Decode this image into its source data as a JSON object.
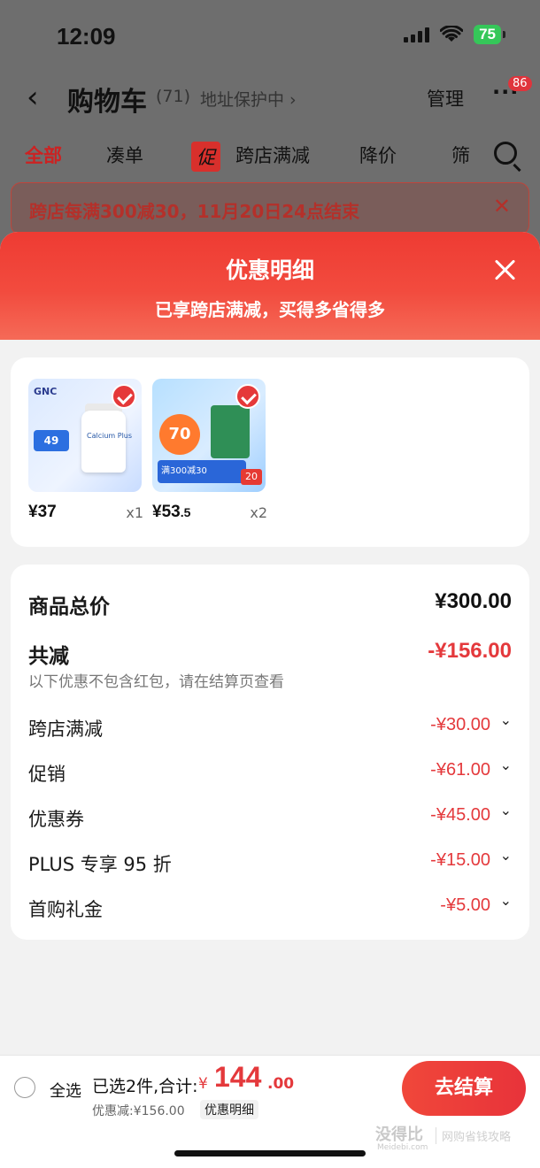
{
  "status_bar": {
    "time": "12:09",
    "battery": "75"
  },
  "navbar": {
    "back_icon": "chevron-left-icon",
    "title": "购物车",
    "count": "(71)",
    "address": "地址保护中 ›",
    "manage": "管理",
    "more": "···",
    "badge": "86"
  },
  "tabs": {
    "all": "全部",
    "together": "凑单",
    "promo_tag": "促",
    "cross_store": "跨店满减",
    "price_drop": "降价",
    "filter": "筛"
  },
  "notice": {
    "text": "跨店每满300减30，11月20日24点结束",
    "close": "✕"
  },
  "sheet": {
    "title": "优惠明细",
    "subtitle": "已享跨店满减，买得多省得多",
    "products": [
      {
        "brand": "GNC",
        "tag": "49",
        "label": "Calcium Plus",
        "price_int": "¥37",
        "price_dec": "",
        "qty": "x1"
      },
      {
        "burst": "70",
        "strip": "满300减30",
        "badge": "20",
        "price_int": "¥53",
        "price_dec": ".5",
        "qty": "x2"
      }
    ],
    "summary": {
      "total_label": "商品总价",
      "total_value": "¥300.00",
      "reduce_label": "共减",
      "reduce_value": "-¥156.00",
      "hint": "以下优惠不包含红包，请在结算页查看",
      "items": [
        {
          "label": "跨店满减",
          "value": "-¥30.00"
        },
        {
          "label": "促销",
          "value": "-¥61.00"
        },
        {
          "label": "优惠券",
          "value": "-¥45.00"
        },
        {
          "label": "PLUS 专享 95 折",
          "value": "-¥15.00"
        },
        {
          "label": "首购礼金",
          "value": "-¥5.00"
        }
      ]
    }
  },
  "bottom_bar": {
    "select_all": "全选",
    "selected": "已选2件,合计:",
    "currency": "¥",
    "total_int": "144",
    "total_dec": ".00",
    "discount": "优惠减:¥156.00",
    "detail": "优惠明细",
    "checkout": "去结算"
  },
  "watermark": {
    "main": "没得比",
    "sub": "Meidebi.com",
    "right": "网购省钱攻略"
  },
  "colors": {
    "accent": "#e4393c",
    "header_gradient_start": "#ee3b33",
    "battery": "#35c759"
  }
}
